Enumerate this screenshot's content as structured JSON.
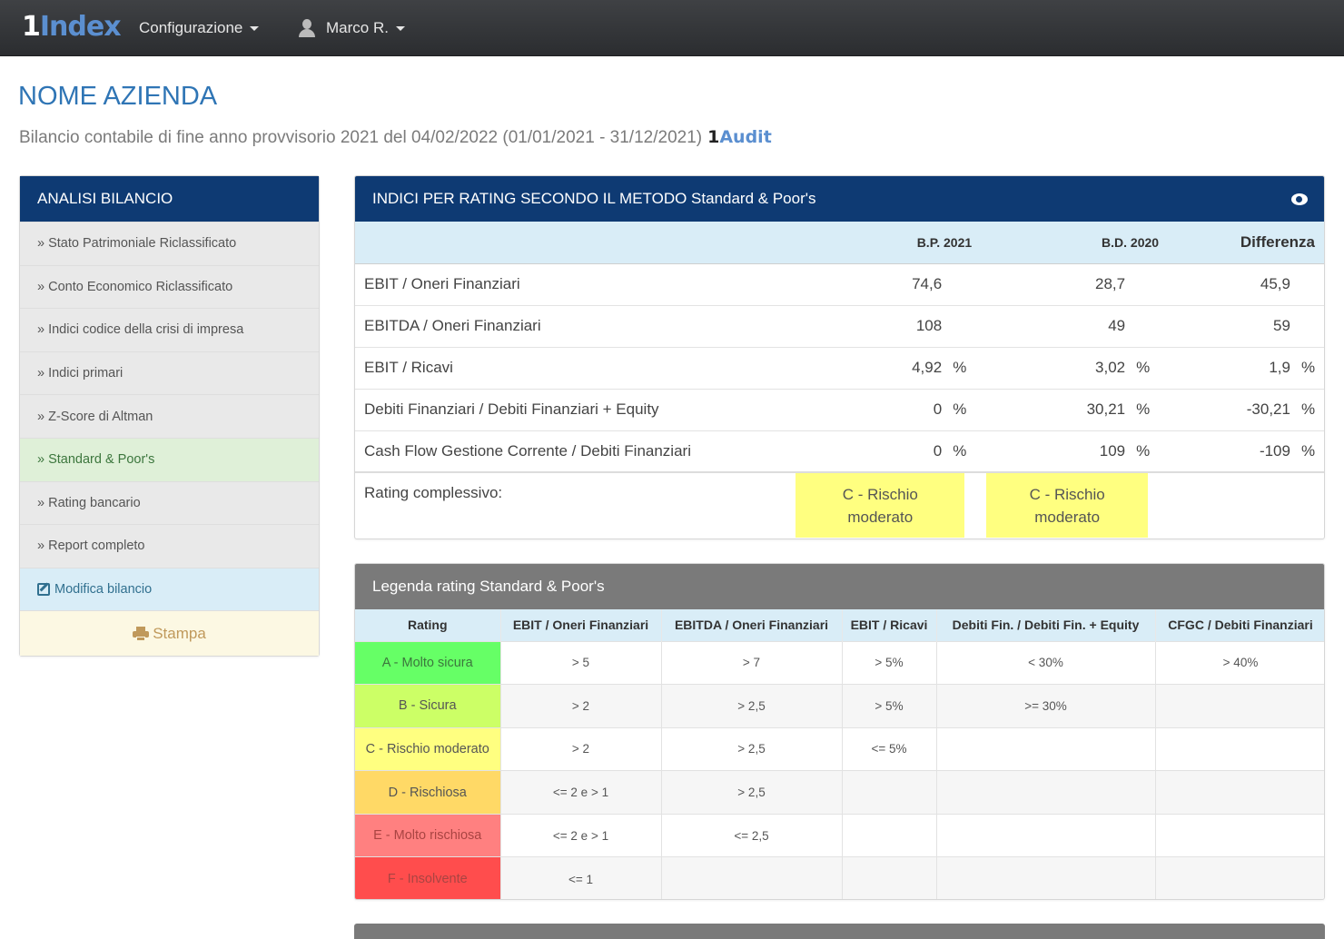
{
  "navbar": {
    "brand_one": "1",
    "brand_word": "Index",
    "menu_config": "Configurazione",
    "menu_user": "Marco R."
  },
  "header": {
    "title": "NOME AZIENDA",
    "subtitle": "Bilancio contabile di fine anno provvisorio 2021 del 04/02/2022 (01/01/2021 - 31/12/2021)",
    "audit_one": "1",
    "audit_word": "Audit"
  },
  "sidebar": {
    "title": "ANALISI BILANCIO",
    "items": [
      {
        "label": "» Stato Patrimoniale Riclassificato"
      },
      {
        "label": "» Conto Economico Riclassificato"
      },
      {
        "label": "» Indici codice della crisi di impresa"
      },
      {
        "label": "» Indici primari"
      },
      {
        "label": "» Z-Score di Altman"
      },
      {
        "label": "» Standard & Poor's"
      },
      {
        "label": "» Rating bancario"
      },
      {
        "label": "» Report completo"
      }
    ],
    "edit_label": "Modifica bilancio",
    "print_label": "Stampa"
  },
  "ratios": {
    "title": "INDICI PER RATING SECONDO IL METODO Standard & Poor's",
    "col_bp": "B.P. 2021",
    "col_bd": "B.D. 2020",
    "col_diff": "Differenza",
    "rows": [
      {
        "label": "EBIT / Oneri Finanziari",
        "bp": "74,6",
        "bd": "28,7",
        "diff": "45,9",
        "unit": ""
      },
      {
        "label": "EBITDA / Oneri Finanziari",
        "bp": "108",
        "bd": "49",
        "diff": "59",
        "unit": ""
      },
      {
        "label": "EBIT / Ricavi",
        "bp": "4,92",
        "bd": "3,02",
        "diff": "1,9",
        "unit": "%"
      },
      {
        "label": "Debiti Finanziari / Debiti Finanziari + Equity",
        "bp": "0",
        "bd": "30,21",
        "diff": "-30,21",
        "unit": "%"
      },
      {
        "label": "Cash Flow Gestione Corrente / Debiti Finanziari",
        "bp": "0",
        "bd": "109",
        "diff": "-109",
        "unit": "%"
      }
    ],
    "overall_label": "Rating complessivo:",
    "overall_bp": "C - Rischio moderato",
    "overall_bd": "C - Rischio moderato",
    "overall_color": "#ffff80"
  },
  "legend": {
    "title": "Legenda rating Standard & Poor's",
    "headers": [
      "Rating",
      "EBIT / Oneri Finanziari",
      "EBITDA / Oneri Finanziari",
      "EBIT / Ricavi",
      "Debiti Fin. / Debiti Fin. + Equity",
      "CFGC / Debiti Finanziari"
    ],
    "rows": [
      {
        "rating": "A - Molto sicura",
        "color": "#66ff66",
        "text_color": "#3c763d",
        "c1": "> 5",
        "c2": "> 7",
        "c3": "> 5%",
        "c4": "< 30%",
        "c5": "> 40%"
      },
      {
        "rating": "B - Sicura",
        "color": "#ccff66",
        "text_color": "#555555",
        "c1": "> 2",
        "c2": "> 2,5",
        "c3": "> 5%",
        "c4": ">= 30%",
        "c5": ""
      },
      {
        "rating": "C - Rischio moderato",
        "color": "#ffff80",
        "text_color": "#555555",
        "c1": "> 2",
        "c2": "> 2,5",
        "c3": "<= 5%",
        "c4": "",
        "c5": ""
      },
      {
        "rating": "D - Rischiosa",
        "color": "#ffd966",
        "text_color": "#555555",
        "c1": "<= 2 e > 1",
        "c2": "> 2,5",
        "c3": "",
        "c4": "",
        "c5": ""
      },
      {
        "rating": "E - Molto rischiosa",
        "color": "#ff8080",
        "text_color": "#a94442",
        "c1": "<= 2 e > 1",
        "c2": "<= 2,5",
        "c3": "",
        "c4": "",
        "c5": ""
      },
      {
        "rating": "F - Insolvente",
        "color": "#ff4d4d",
        "text_color": "#a94442",
        "c1": "<= 1",
        "c2": "",
        "c3": "",
        "c4": "",
        "c5": ""
      }
    ]
  }
}
